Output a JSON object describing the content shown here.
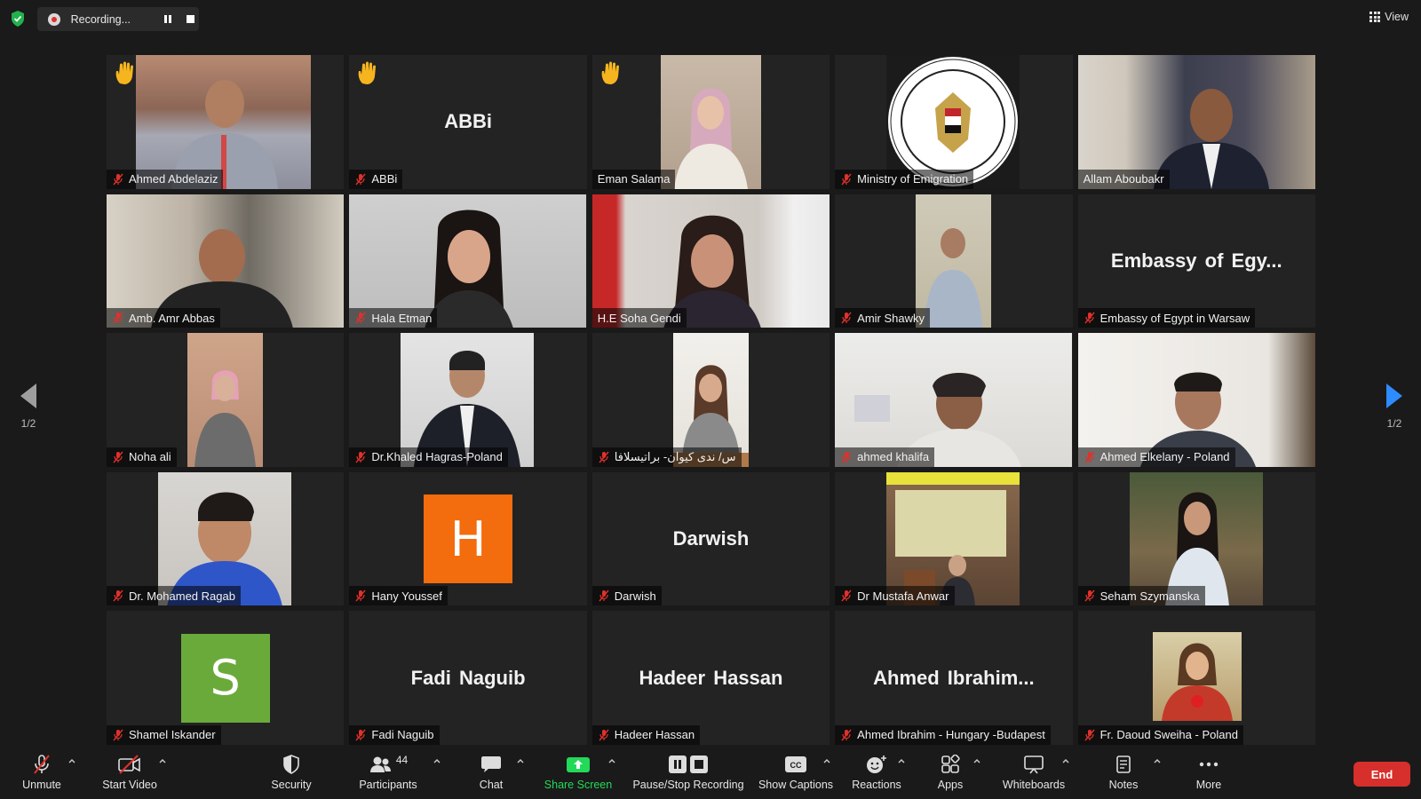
{
  "top_bar": {
    "recording_label": "Recording...",
    "view_label": "View"
  },
  "navigation": {
    "left_page": "1/2",
    "right_page": "1/2"
  },
  "participants": [
    {
      "name": "Ahmed Abdelaziz",
      "hand_raised": true,
      "muted": true,
      "video": true
    },
    {
      "name": "ABBi",
      "display": "ABBi",
      "hand_raised": true,
      "muted": true,
      "video": false
    },
    {
      "name": "Eman Salama",
      "hand_raised": true,
      "muted": false,
      "video": true
    },
    {
      "name": "Ministry of Emigration",
      "muted": true,
      "video": true
    },
    {
      "name": "Allam Aboubakr",
      "muted": false,
      "video": true
    },
    {
      "name": "Amb. Amr Abbas",
      "muted": true,
      "video": true
    },
    {
      "name": "Hala Etman",
      "muted": true,
      "video": true
    },
    {
      "name": "H.E Soha Gendi",
      "muted": false,
      "video": true,
      "active_speaker": true
    },
    {
      "name": "Amir Shawky",
      "muted": true,
      "video": true
    },
    {
      "name": "Embassy of Egypt in Warsaw",
      "display": "Embassy of Egy...",
      "muted": true,
      "video": false
    },
    {
      "name": "Noha ali",
      "muted": true,
      "video": true
    },
    {
      "name": "Dr.Khaled Hagras-Poland",
      "muted": true,
      "video": true
    },
    {
      "name": "س/ ندى كيوان- براتيسلافا",
      "muted": true,
      "video": true
    },
    {
      "name": "ahmed khalifa",
      "muted": true,
      "video": true
    },
    {
      "name": "Ahmed Elkelany - Poland",
      "muted": true,
      "video": true
    },
    {
      "name": "Dr. Mohamed Ragab",
      "muted": true,
      "video": true
    },
    {
      "name": "Hany Youssef",
      "avatar_letter": "H",
      "avatar_color": "#f36c0d",
      "muted": true,
      "video": false
    },
    {
      "name": "Darwish",
      "display": "Darwish",
      "muted": true,
      "video": false
    },
    {
      "name": "Dr Mustafa Anwar",
      "muted": true,
      "video": true
    },
    {
      "name": "Seham Szymanska",
      "muted": true,
      "video": true
    },
    {
      "name": "Shamel Iskander",
      "avatar_letter": "S",
      "avatar_color": "#6aaa3a",
      "muted": true,
      "video": false
    },
    {
      "name": "Fadi Naguib",
      "display": "Fadi Naguib",
      "muted": true,
      "video": false
    },
    {
      "name": "Hadeer Hassan",
      "display": "Hadeer Hassan",
      "muted": true,
      "video": false
    },
    {
      "name": "Ahmed Ibrahim - Hungary -Budapest",
      "display": "Ahmed  Ibrahim...",
      "muted": true,
      "video": false
    },
    {
      "name": "Fr. Daoud Sweiha - Poland",
      "muted": true,
      "video": true
    }
  ],
  "toolbar": {
    "unmute": "Unmute",
    "start_video": "Start Video",
    "security": "Security",
    "participants": "Participants",
    "participants_count": "44",
    "chat": "Chat",
    "share_screen": "Share Screen",
    "pause_stop_recording": "Pause/Stop Recording",
    "show_captions": "Show Captions",
    "reactions": "Reactions",
    "apps": "Apps",
    "whiteboards": "Whiteboards",
    "notes": "Notes",
    "more": "More",
    "end": "End"
  },
  "colors": {
    "background": "#1a1a1a",
    "tile": "#232323",
    "active_speaker_border": "#c8e03e",
    "share_screen_green": "#23d959",
    "end_red": "#d72f2b",
    "mute_red": "#e0312b",
    "hand_yellow": "#f6b51e",
    "nav_blue": "#2d8cff"
  }
}
